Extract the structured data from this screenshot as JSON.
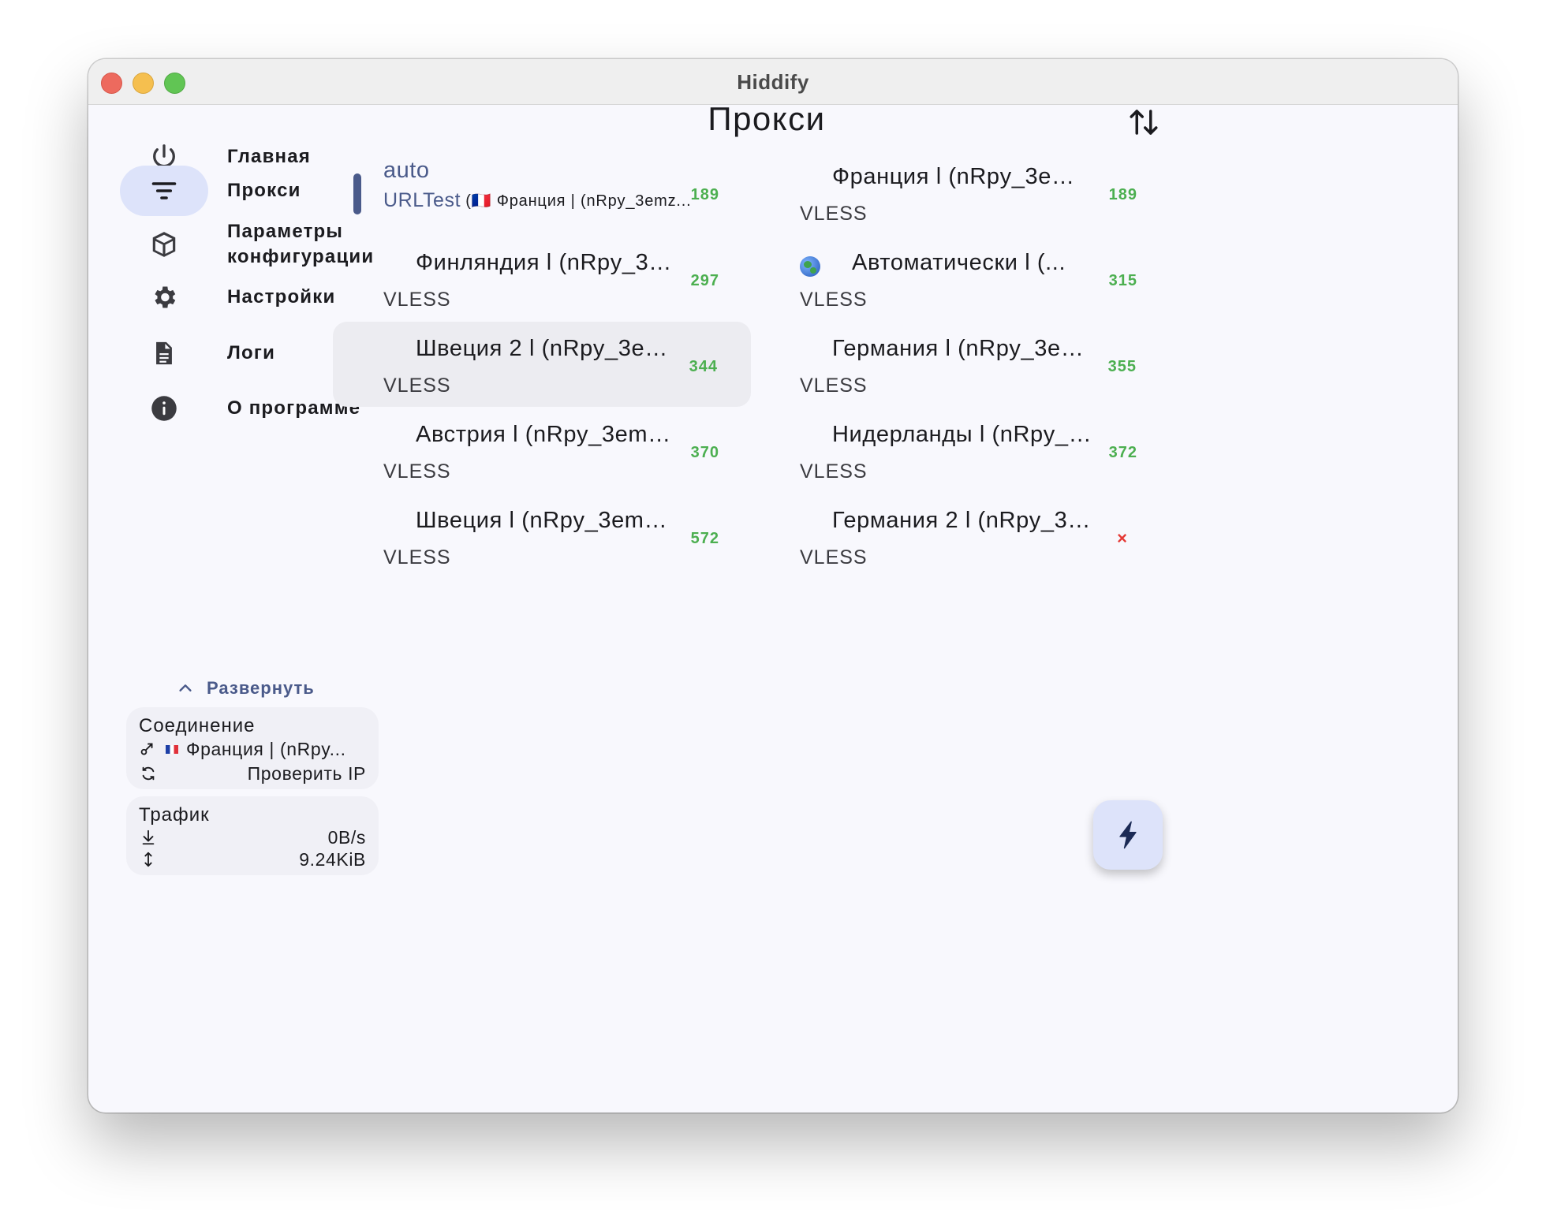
{
  "window": {
    "title": "Hiddify"
  },
  "sidebar": {
    "items": [
      {
        "label": "Главная",
        "icon": "power-icon"
      },
      {
        "label": "Прокси",
        "icon": "filter-icon",
        "active": true
      },
      {
        "label": "Параметры конфигурации",
        "icon": "box-icon"
      },
      {
        "label": "Настройки",
        "icon": "gear-icon"
      },
      {
        "label": "Логи",
        "icon": "document-icon"
      },
      {
        "label": "О программе",
        "icon": "info-icon"
      }
    ],
    "expand_label": "Развернуть",
    "connection": {
      "title": "Соединение",
      "current": "Франция | (nRpy...",
      "check_ip": "Проверить IP"
    },
    "traffic": {
      "title": "Трафик",
      "speed": "0B/s",
      "total": "9.24KiB"
    }
  },
  "main": {
    "title": "Прокси",
    "auto": {
      "name": "auto",
      "type": "URLTest",
      "selected": "(🇫🇷 Франция | (nRpy_3emz...",
      "delay": "189"
    },
    "proxies": [
      {
        "name": "Франция l (nRpy_3emz_...",
        "type": "VLESS",
        "delay": "189"
      },
      {
        "name": "Финляндия l (nRpy_3e...",
        "type": "VLESS",
        "delay": "297"
      },
      {
        "name": "Автоматически   l   (...",
        "type": "VLESS",
        "delay": "315",
        "icon": "globe-icon"
      },
      {
        "name": "Швеция 2 l (nRpy_3emz...",
        "type": "VLESS",
        "delay": "344"
      },
      {
        "name": "Германия l (nRpy_3emz...",
        "type": "VLESS",
        "delay": "355"
      },
      {
        "name": "Австрия l (nRpy_3emz_...",
        "type": "VLESS",
        "delay": "370"
      },
      {
        "name": "Нидерланды l (nRpy_3e...",
        "type": "VLESS",
        "delay": "372"
      },
      {
        "name": "Швеция l (nRpy_3emz_...",
        "type": "VLESS",
        "delay": "572"
      },
      {
        "name": "Германия 2 l (nRpy_3e...",
        "type": "VLESS",
        "delay": "×"
      }
    ]
  },
  "colors": {
    "accent": "#4a5a8a",
    "active_bg": "#dde3fa",
    "delay_ok": "#4caf50",
    "delay_err": "#e53935"
  }
}
